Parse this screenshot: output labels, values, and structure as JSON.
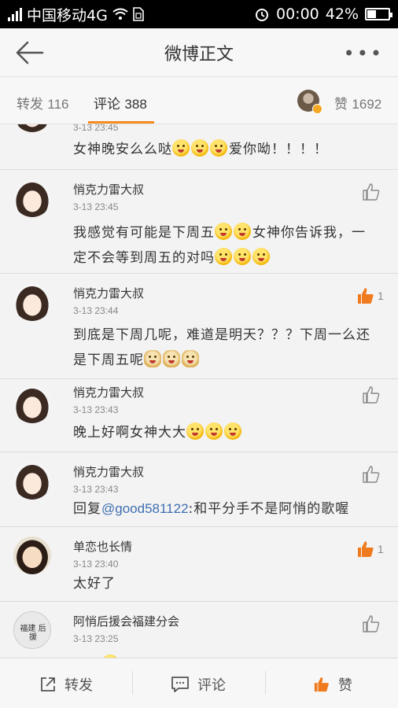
{
  "status_bar": {
    "carrier": "中国移动4G",
    "time": "00:00",
    "battery": "42%",
    "battery_level": 0.42,
    "icons": [
      "signal-icon",
      "wifi-icon",
      "sim-icon",
      "alarm-icon",
      "battery-icon"
    ]
  },
  "header": {
    "title": "微博正文",
    "more_label": "•••"
  },
  "tabs": {
    "repost_label": "转发",
    "repost_count": "116",
    "comment_label": "评论",
    "comment_count": "388",
    "like_label": "赞",
    "like_count": "1692"
  },
  "comments": [
    {
      "user": "",
      "time": "3-13 23:45",
      "text": "女神晚安么么哒",
      "text_suffix": "爱你呦！！！！",
      "likes": ""
    },
    {
      "user": "悄克力雷大叔",
      "time": "3-13 23:45",
      "text_line1a": "我感觉有可能是下周五",
      "text_line1b": "女神你告诉我，一",
      "text_line2": "定不会等到周五的对吗",
      "likes": ""
    },
    {
      "user": "悄克力雷大叔",
      "time": "3-13 23:44",
      "text_line1": "到底是下周几呢，难道是明天？？？下周一么还",
      "text_line2": "是下周五呢",
      "likes": "1"
    },
    {
      "user": "悄克力雷大叔",
      "time": "3-13 23:43",
      "text": "晚上好啊女神大大",
      "likes": ""
    },
    {
      "user": "悄克力雷大叔",
      "time": "3-13 23:43",
      "text_prefix": "回复",
      "mention": "@good581122",
      "text_rest": ":和平分手不是阿悄的歌喔",
      "likes": ""
    },
    {
      "user": "单恋也长情",
      "time": "3-13 23:40",
      "text": "太好了",
      "likes": "1"
    },
    {
      "user": "阿悄后援会福建分会",
      "time": "3-13 23:25",
      "avatar_text": "福建 后援",
      "text": "",
      "likes": ""
    }
  ],
  "bottom_bar": {
    "repost": "转发",
    "comment": "评论",
    "like": "赞"
  },
  "colors": {
    "accent": "#f58c1e",
    "link": "#3f6fb0",
    "like_active": "#f07b1e"
  }
}
